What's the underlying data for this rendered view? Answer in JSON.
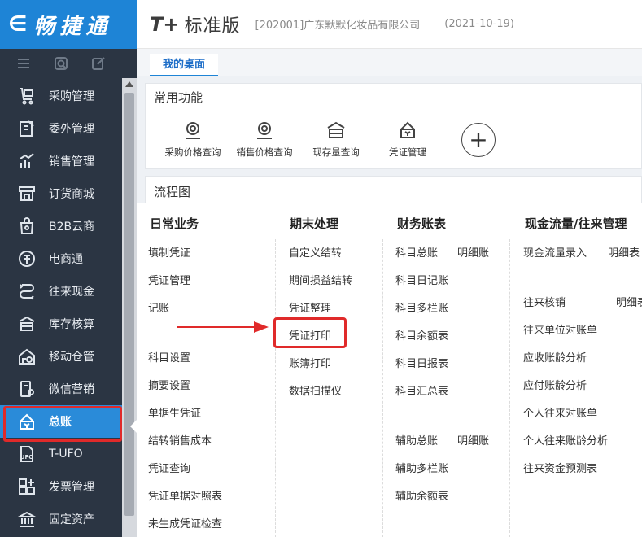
{
  "app": {
    "logo_back": "∈",
    "logo_text": "畅捷通",
    "brand": "T+",
    "edition": "标准版",
    "company": "[202001]广东默默化妆品有限公司",
    "date": "(2021-10-19)"
  },
  "tabs": [
    {
      "label": "我的桌面",
      "active": true
    }
  ],
  "sidebar": {
    "tool_icons": [
      "menu-icon",
      "search-icon",
      "edit-icon"
    ],
    "items": [
      {
        "label": "采购管理",
        "icon": "cart-icon"
      },
      {
        "label": "委外管理",
        "icon": "outsource-icon"
      },
      {
        "label": "销售管理",
        "icon": "sales-chart-icon"
      },
      {
        "label": "订货商城",
        "icon": "shop-icon"
      },
      {
        "label": "B2B云商",
        "icon": "bag-icon"
      },
      {
        "label": "电商通",
        "icon": "ecommerce-icon"
      },
      {
        "label": "往来现金",
        "icon": "cash-flow-icon"
      },
      {
        "label": "库存核算",
        "icon": "inventory-icon"
      },
      {
        "label": "移动仓管",
        "icon": "mobile-warehouse-icon"
      },
      {
        "label": "微信营销",
        "icon": "wechat-icon"
      },
      {
        "label": "总账",
        "icon": "ledger-icon",
        "active": true
      },
      {
        "label": "T-UFO",
        "icon": "ufo-icon"
      },
      {
        "label": "发票管理",
        "icon": "invoice-icon"
      },
      {
        "label": "固定资产",
        "icon": "bank-icon"
      }
    ],
    "highlight_color": "#e02a2a",
    "active_color": "#2a8bd9"
  },
  "common_functions": {
    "title": "常用功能",
    "items": [
      {
        "label": "采购价格查询",
        "icon": "gear-price-icon"
      },
      {
        "label": "销售价格查询",
        "icon": "gear-price-icon"
      },
      {
        "label": "现存量查询",
        "icon": "stock-icon"
      },
      {
        "label": "凭证管理",
        "icon": "voucher-icon"
      }
    ],
    "add_label": "+"
  },
  "flow": {
    "title": "流程图",
    "columns": [
      {
        "title": "日常业务",
        "links": [
          "填制凭证",
          "凭证管理",
          "记账",
          "科目设置",
          "摘要设置",
          "单据生凭证",
          "结转销售成本",
          "凭证查询",
          "凭证单据对照表",
          "未生成凭证检查"
        ]
      },
      {
        "title": "期末处理",
        "links": [
          "自定义结转",
          "期间损益结转",
          "凭证整理",
          "凭证打印",
          "账簿打印",
          "数据扫描仪"
        ]
      },
      {
        "title": "财务账表",
        "links": [
          "科目总账",
          "明细账",
          "科目日记账",
          "科目多栏账",
          "科目余额表",
          "科目日报表",
          "科目汇总表",
          "辅助总账",
          "明细账",
          "辅助多栏账",
          "辅助余额表"
        ]
      },
      {
        "title": "现金流量/往来管理",
        "links": [
          "现金流量录入",
          "明细表",
          "往来核销",
          "明细表",
          "往来单位对账单",
          "应收账龄分析",
          "应付账龄分析",
          "个人往来对账单",
          "个人往来账龄分析",
          "往来资金预测表"
        ]
      }
    ]
  }
}
